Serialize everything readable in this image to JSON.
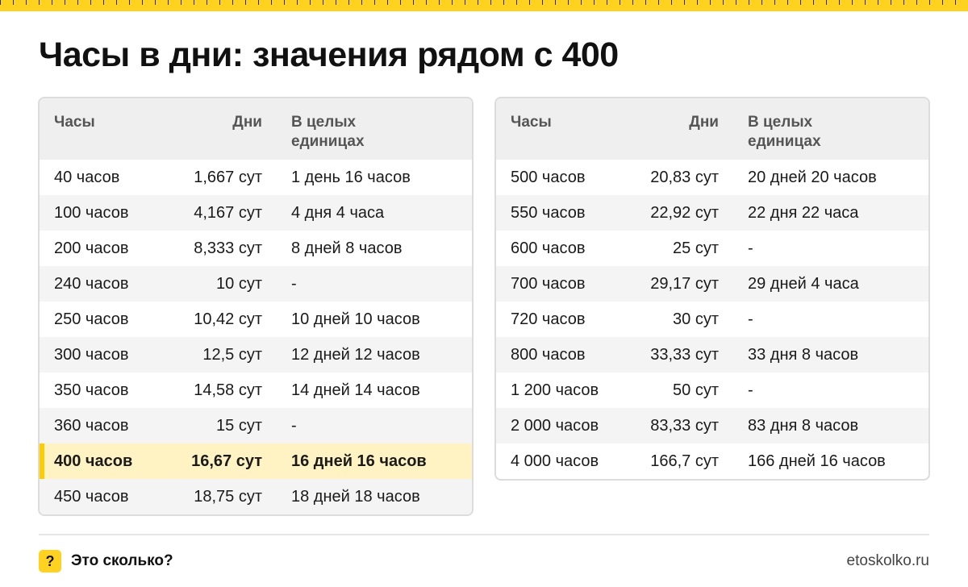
{
  "title": "Часы в дни: значения рядом с 400",
  "colors": {
    "accent": "#ffd21f",
    "highlight": "#fff3c4",
    "header_bg": "#efefef"
  },
  "headers": {
    "hours": "Часы",
    "days": "Дни",
    "whole": "В целых единицах"
  },
  "left_table": {
    "rows": [
      {
        "hours": "40 часов",
        "days": "1,667 сут",
        "whole": "1 день 16 часов",
        "highlight": false
      },
      {
        "hours": "100 часов",
        "days": "4,167 сут",
        "whole": "4 дня 4 часа",
        "highlight": false
      },
      {
        "hours": "200 часов",
        "days": "8,333 сут",
        "whole": "8 дней 8 часов",
        "highlight": false
      },
      {
        "hours": "240 часов",
        "days": "10 сут",
        "whole": "-",
        "highlight": false
      },
      {
        "hours": "250 часов",
        "days": "10,42 сут",
        "whole": "10 дней 10 часов",
        "highlight": false
      },
      {
        "hours": "300 часов",
        "days": "12,5 сут",
        "whole": "12 дней 12 часов",
        "highlight": false
      },
      {
        "hours": "350 часов",
        "days": "14,58 сут",
        "whole": "14 дней 14 часов",
        "highlight": false
      },
      {
        "hours": "360 часов",
        "days": "15 сут",
        "whole": "-",
        "highlight": false
      },
      {
        "hours": "400 часов",
        "days": "16,67 сут",
        "whole": "16 дней 16 часов",
        "highlight": true
      },
      {
        "hours": "450 часов",
        "days": "18,75 сут",
        "whole": "18 дней 18 часов",
        "highlight": false
      }
    ]
  },
  "right_table": {
    "rows": [
      {
        "hours": "500 часов",
        "days": "20,83 сут",
        "whole": "20 дней 20 часов",
        "highlight": false
      },
      {
        "hours": "550 часов",
        "days": "22,92 сут",
        "whole": "22 дня 22 часа",
        "highlight": false
      },
      {
        "hours": "600 часов",
        "days": "25 сут",
        "whole": "-",
        "highlight": false
      },
      {
        "hours": "700 часов",
        "days": "29,17 сут",
        "whole": "29 дней 4 часа",
        "highlight": false
      },
      {
        "hours": "720 часов",
        "days": "30 сут",
        "whole": "-",
        "highlight": false
      },
      {
        "hours": "800 часов",
        "days": "33,33 сут",
        "whole": "33 дня 8 часов",
        "highlight": false
      },
      {
        "hours": "1 200 часов",
        "days": "50 сут",
        "whole": "-",
        "highlight": false
      },
      {
        "hours": "2 000 часов",
        "days": "83,33 сут",
        "whole": "83 дня 8 часов",
        "highlight": false
      },
      {
        "hours": "4 000 часов",
        "days": "166,7 сут",
        "whole": "166 дней 16 часов",
        "highlight": false
      }
    ]
  },
  "footer": {
    "icon": "question-icon",
    "icon_glyph": "?",
    "brand": "Это сколько?",
    "site": "etoskolko.ru"
  }
}
